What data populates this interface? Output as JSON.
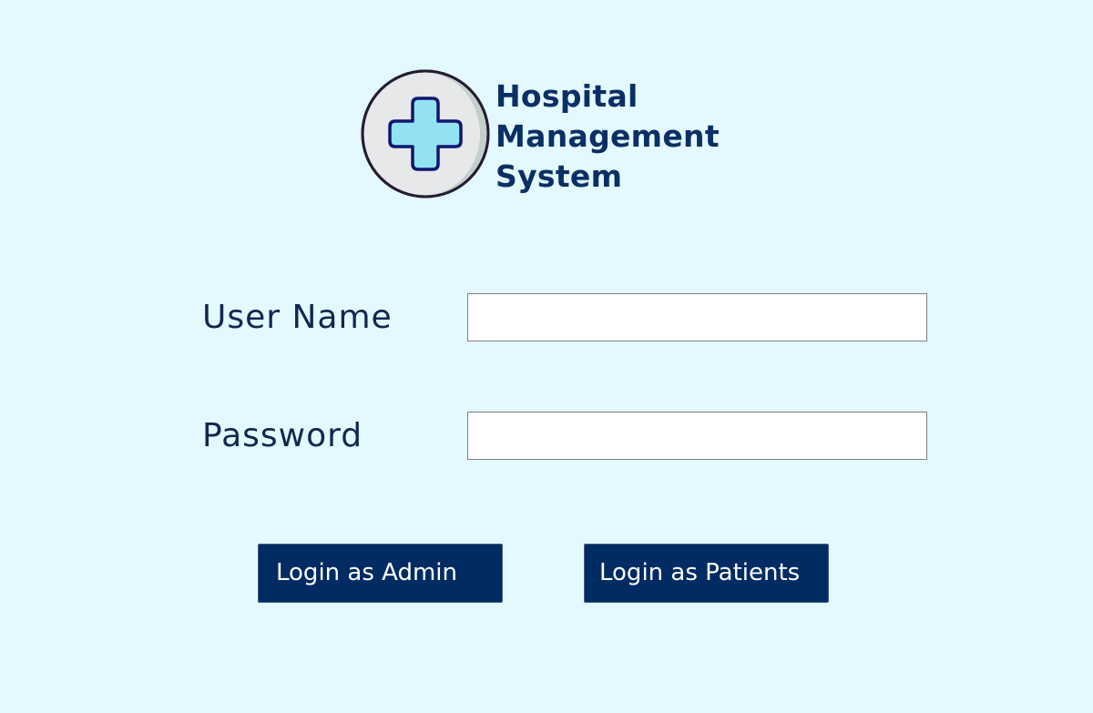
{
  "header": {
    "logo_icon": "medical-cross-icon",
    "title_lines": [
      "Hospital",
      "Management",
      "System"
    ]
  },
  "form": {
    "username_label": "User Name",
    "username_value": "",
    "password_label": "Password",
    "password_value": ""
  },
  "actions": {
    "admin_login_label": "Login as Admin",
    "patients_login_label": "Login as Patients"
  },
  "colors": {
    "background": "#e3f9fe",
    "title": "#0a2f65",
    "button": "#002b63",
    "cross_fill": "#93e2f2"
  }
}
